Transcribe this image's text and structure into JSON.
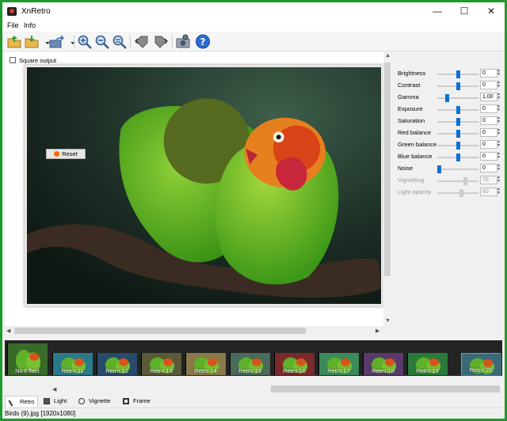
{
  "window": {
    "title": "XnRetro",
    "minimize": "—",
    "maximize": "☐",
    "close": "✕"
  },
  "menu": {
    "items": [
      "File",
      "Info"
    ]
  },
  "toolbar": {
    "icons": [
      "open-icon",
      "save-icon",
      "export-icon",
      "zoom-in-icon",
      "zoom-out-icon",
      "zoom-fit-icon",
      "rotate-left-icon",
      "rotate-right-icon",
      "camera-icon",
      "help-icon"
    ]
  },
  "panel": {
    "square_output": "Square output",
    "sliders": [
      {
        "label": "Brightness",
        "value": "0",
        "level": 0.5,
        "enabled": true
      },
      {
        "label": "Contrast",
        "value": "0",
        "level": 0.5,
        "enabled": true
      },
      {
        "label": "Gamma",
        "value": "1,00",
        "level": 0.22,
        "enabled": true
      },
      {
        "label": "Exposure",
        "value": "0",
        "level": 0.5,
        "enabled": true
      },
      {
        "label": "Saturation",
        "value": "0",
        "level": 0.5,
        "enabled": true
      },
      {
        "label": "Red balance",
        "value": "0",
        "level": 0.5,
        "enabled": true
      },
      {
        "label": "Green balance",
        "value": "0",
        "level": 0.5,
        "enabled": true
      },
      {
        "label": "Blue balance",
        "value": "0",
        "level": 0.5,
        "enabled": true
      },
      {
        "label": "Noise",
        "value": "0",
        "level": 0.0,
        "enabled": true
      },
      {
        "label": "Vignetting",
        "value": "70",
        "level": 0.7,
        "enabled": false
      },
      {
        "label": "Light opacity",
        "value": "60",
        "level": 0.6,
        "enabled": false
      }
    ],
    "reset_label": "Reset"
  },
  "effects": [
    {
      "label": "No Effect",
      "tint": "#3a6a2a"
    },
    {
      "label": "Retro 11",
      "tint": "#2a7a8a"
    },
    {
      "label": "Retro 12",
      "tint": "#2a4a6a"
    },
    {
      "label": "Retro 13",
      "tint": "#5a5a3a"
    },
    {
      "label": "Retro 14",
      "tint": "#8a7a4a"
    },
    {
      "label": "Retro 15",
      "tint": "#4a6a5a"
    },
    {
      "label": "Retro 16",
      "tint": "#7a2a2a"
    },
    {
      "label": "Retro 17",
      "tint": "#3a8a5a"
    },
    {
      "label": "Retro 18",
      "tint": "#5a3a6a"
    },
    {
      "label": "Retro 19",
      "tint": "#2a7a3a"
    },
    {
      "label": "Retro 20",
      "tint": "#3a6a7a"
    }
  ],
  "tabs": [
    "Retro",
    "Light",
    "Vignette",
    "Frame"
  ],
  "status": "Birds (9).jpg [1920x1080]"
}
